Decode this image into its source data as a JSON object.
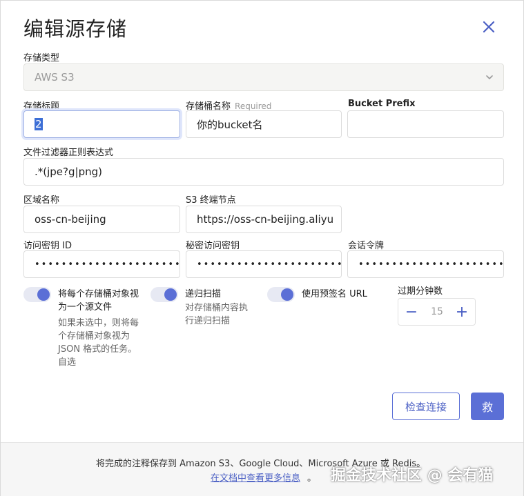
{
  "dialog": {
    "title": "编辑源存储",
    "close_icon": "close-icon"
  },
  "fields": {
    "storage_type": {
      "label": "存储类型",
      "value": "AWS S3",
      "icon": "chevron-down-icon"
    },
    "storage_title": {
      "label": "存储标题",
      "value": "2"
    },
    "bucket_name": {
      "label": "存储桶名称",
      "required": "Required",
      "value": "你的bucket名"
    },
    "bucket_prefix": {
      "label": "Bucket Prefix",
      "value": ""
    },
    "file_filter": {
      "label": "文件过滤器正则表达式",
      "value": ".*(jpe?g|png)"
    },
    "region": {
      "label": "区域名称",
      "value": "oss-cn-beijing"
    },
    "endpoint": {
      "label": "S3 终端节点",
      "value": "https://oss-cn-beijing.aliyu"
    },
    "access_key": {
      "label": "访问密钥 ID",
      "value": "••••••••••••••••••••••••••"
    },
    "secret_key": {
      "label": "秘密访问密钥",
      "value": "••••••••••••••••••••••••••"
    },
    "session_token": {
      "label": "会话令牌",
      "value": "••••••••••••••••••••••••••"
    }
  },
  "toggles": {
    "treat_as_source": {
      "label_line1": "将每个存储桶对象视",
      "label_line2": "为一个源文件",
      "desc_line1": "如果未选中，则将每",
      "desc_line2": "个存储桶对象视为",
      "desc_line3": "JSON 格式的任务。",
      "desc_line4": "自选",
      "on": true
    },
    "recursive_scan": {
      "label": "递归扫描",
      "desc_line1": "对存储桶内容执",
      "desc_line2": "行递归扫描",
      "on": true
    },
    "presigned_url": {
      "label": "使用预签名 URL",
      "on": true
    }
  },
  "expiry": {
    "label": "过期分钟数",
    "value": "15",
    "minus": "−",
    "plus": "+"
  },
  "buttons": {
    "check_connection": "检查连接",
    "save": "救"
  },
  "footer": {
    "text": "将完成的注释保存到 Amazon S3、Google Cloud、Microsoft Azure 或 Redis。",
    "link": "在文档中查看更多信息",
    "period": "。"
  },
  "watermark": "掘金技术社区 @ 会有猫",
  "colors": {
    "accent": "#5b6fd6",
    "disabled_bg": "#f5f5f3",
    "footer_bg": "#f6f6f6"
  }
}
